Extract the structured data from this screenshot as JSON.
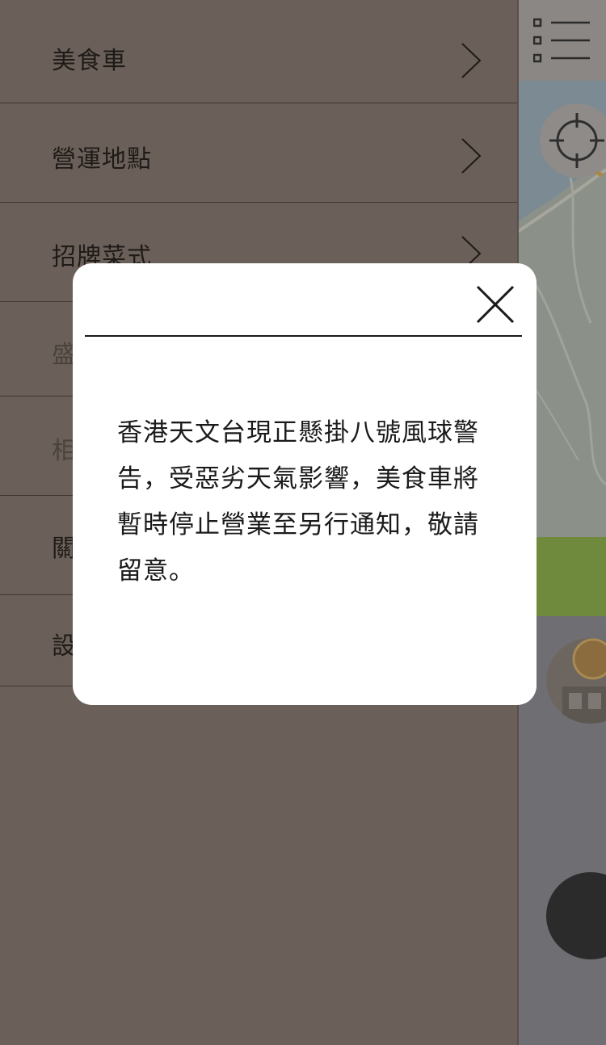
{
  "drawer": {
    "items": [
      {
        "label": "美食車"
      },
      {
        "label": "營運地點"
      },
      {
        "label": "招牌菜式"
      },
      {
        "label": "盛"
      },
      {
        "label": "相"
      },
      {
        "label": "關"
      },
      {
        "label": "設"
      }
    ]
  },
  "modal": {
    "message": "香港天文台現正懸掛八號風球警告，受惡劣天氣影響，美食車將暫時停止營業至另行通知，敬請留意。"
  },
  "icons": {
    "menu": "list-menu-icon",
    "locate": "crosshair-icon",
    "close": "close-icon",
    "chevron": "chevron-right-icon"
  },
  "colors": {
    "overlay_drawer": "#6a6059",
    "modal_bg": "#ffffff",
    "text_dark": "#1a1a1a"
  }
}
